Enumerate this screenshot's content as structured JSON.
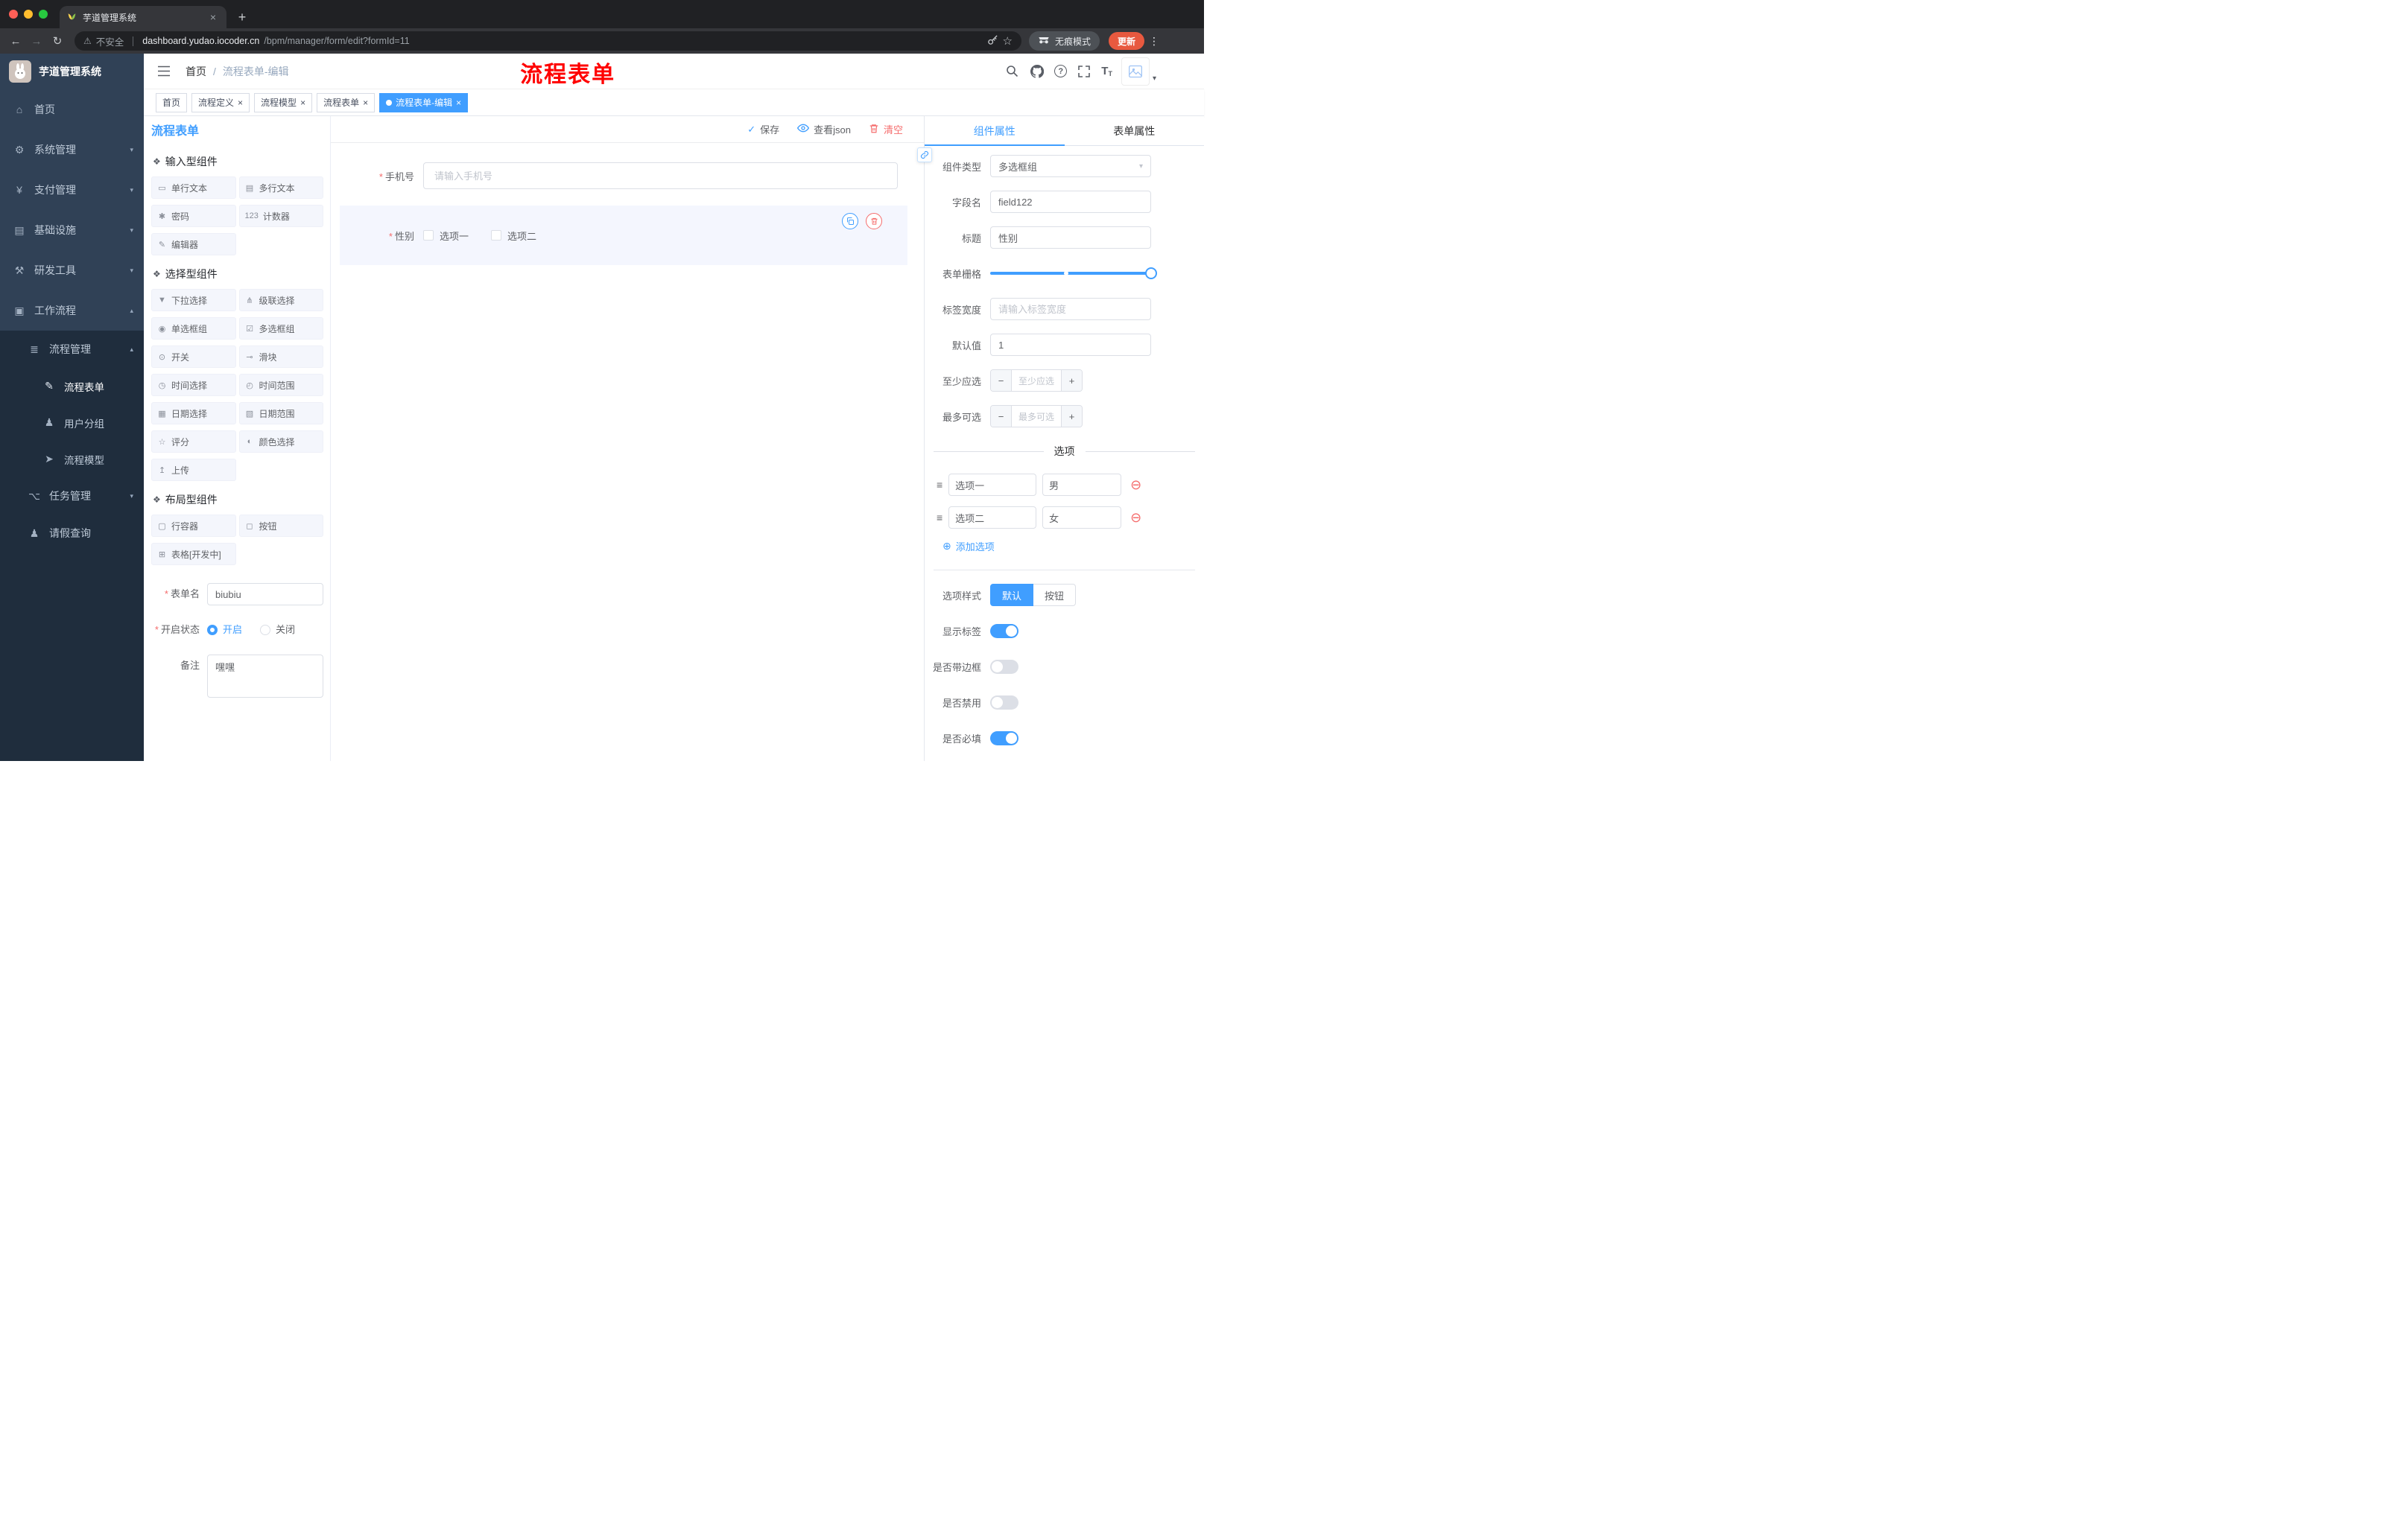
{
  "browser": {
    "tab_title": "芋道管理系统",
    "security_label": "不安全",
    "url_host": "dashboard.yudao.iocoder.cn",
    "url_path": "/bpm/manager/form/edit?formId=11",
    "incognito_label": "无痕模式",
    "update_label": "更新"
  },
  "sidebar": {
    "app_title": "芋道管理系统",
    "items": [
      {
        "icon": "⌂",
        "label": "首页"
      },
      {
        "icon": "⚙",
        "label": "系统管理",
        "arrow": "▾"
      },
      {
        "icon": "¥",
        "label": "支付管理",
        "arrow": "▾"
      },
      {
        "icon": "▤",
        "label": "基础设施",
        "arrow": "▾"
      },
      {
        "icon": "⚒",
        "label": "研发工具",
        "arrow": "▾"
      },
      {
        "icon": "▣",
        "label": "工作流程",
        "arrow": "▴"
      },
      {
        "icon": "≣",
        "label": "流程管理",
        "arrow": "▴"
      },
      {
        "icon": "✎",
        "label": "流程表单"
      },
      {
        "icon": "♟",
        "label": "用户分组"
      },
      {
        "icon": "➤",
        "label": "流程模型"
      },
      {
        "icon": "⌥",
        "label": "任务管理",
        "arrow": "▾"
      },
      {
        "icon": "♟",
        "label": "请假查询"
      }
    ]
  },
  "header": {
    "breadcrumb_home": "首页",
    "breadcrumb_sep": "/",
    "breadcrumb_current": "流程表单-编辑",
    "annotation": "流程表单"
  },
  "tags": [
    {
      "label": "首页"
    },
    {
      "label": "流程定义"
    },
    {
      "label": "流程模型"
    },
    {
      "label": "流程表单"
    },
    {
      "label": "流程表单-编辑"
    }
  ],
  "designer": {
    "panel_title": "流程表单",
    "actions": {
      "save": "保存",
      "view_json": "查看json",
      "clear": "清空"
    },
    "palette": {
      "sections": [
        {
          "title": "输入型组件",
          "items": [
            {
              "icon": "▭",
              "label": "单行文本"
            },
            {
              "icon": "▤",
              "label": "多行文本"
            },
            {
              "icon": "✱",
              "label": "密码"
            },
            {
              "icon": "123",
              "label": "计数器"
            },
            {
              "icon": "✎",
              "label": "编辑器"
            }
          ]
        },
        {
          "title": "选择型组件",
          "items": [
            {
              "icon": "▼",
              "label": "下拉选择"
            },
            {
              "icon": "⋔",
              "label": "级联选择"
            },
            {
              "icon": "◉",
              "label": "单选框组"
            },
            {
              "icon": "☑",
              "label": "多选框组"
            },
            {
              "icon": "⊙",
              "label": "开关"
            },
            {
              "icon": "⊸",
              "label": "滑块"
            },
            {
              "icon": "◷",
              "label": "时间选择"
            },
            {
              "icon": "◴",
              "label": "时间范围"
            },
            {
              "icon": "▦",
              "label": "日期选择"
            },
            {
              "icon": "▧",
              "label": "日期范围"
            },
            {
              "icon": "☆",
              "label": "评分"
            },
            {
              "icon": "◐",
              "label": "颜色选择"
            },
            {
              "icon": "↥",
              "label": "上传"
            }
          ]
        },
        {
          "title": "布局型组件",
          "items": [
            {
              "icon": "▢",
              "label": "行容器"
            },
            {
              "icon": "◻",
              "label": "按钮"
            },
            {
              "icon": "⊞",
              "label": "表格[开发中]"
            }
          ]
        }
      ]
    },
    "meta": {
      "name_label": "表单名",
      "name_value": "biubiu",
      "status_label": "开启状态",
      "status_on": "开启",
      "status_off": "关闭",
      "remark_label": "备注",
      "remark_value": "嘿嘿"
    },
    "canvas": {
      "phone_label": "手机号",
      "phone_placeholder": "请输入手机号",
      "gender_label": "性别",
      "gender_option1": "选项一",
      "gender_option2": "选项二"
    }
  },
  "props": {
    "tab_component": "组件属性",
    "tab_form": "表单属性",
    "rows": {
      "type_label": "组件类型",
      "type_value": "多选框组",
      "field_label": "字段名",
      "field_value": "field122",
      "title_label": "标题",
      "title_value": "性别",
      "grid_label": "表单栅格",
      "width_label": "标签宽度",
      "width_placeholder": "请输入标签宽度",
      "default_label": "默认值",
      "default_value": "1",
      "min_label": "至少应选",
      "min_placeholder": "至少应选",
      "max_label": "最多可选",
      "max_placeholder": "最多可选"
    },
    "options_title": "选项",
    "options": [
      {
        "name": "选项一",
        "value": "男"
      },
      {
        "name": "选项二",
        "value": "女"
      }
    ],
    "add_option": "添加选项",
    "style_label": "选项样式",
    "style_default": "默认",
    "style_button": "按钮",
    "switch_show_label": "显示标签",
    "switch_border": "是否带边框",
    "switch_disabled": "是否禁用",
    "switch_required": "是否必填"
  },
  "colors": {
    "primary": "#409eff",
    "danger": "#f56c6c",
    "sidebar": "#304156",
    "sidebar_dark": "#1f2d3d"
  }
}
